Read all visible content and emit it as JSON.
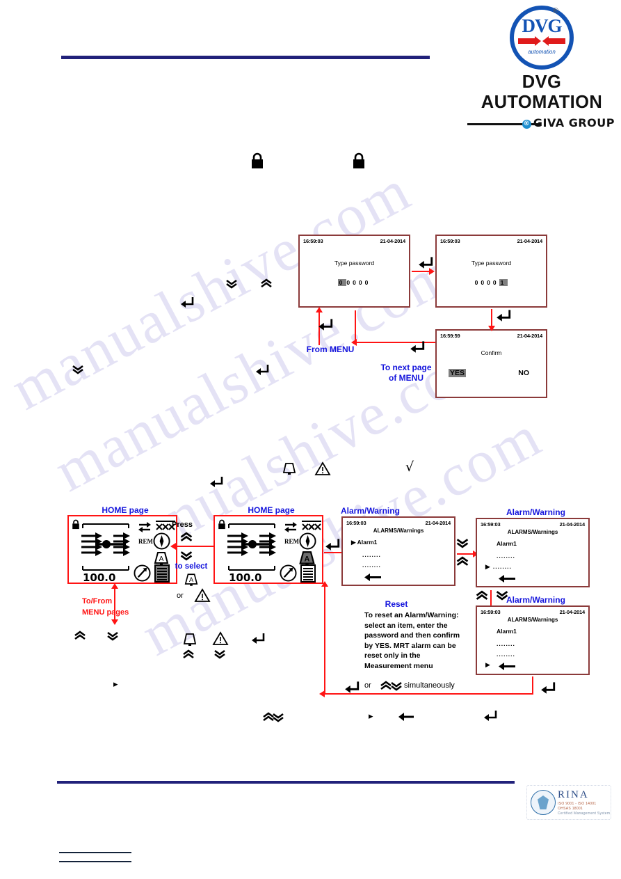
{
  "header": {
    "logo": {
      "mark_text": "DVG",
      "mark_sub": "automation",
      "registered": "®",
      "company": "DVG AUTOMATION",
      "group_badge": "®",
      "group": "GIVA GROUP"
    }
  },
  "watermark": {
    "text": "manualshive.com"
  },
  "symbols": {
    "padlock_left": "padlock-locked",
    "padlock_right": "padlock-locked",
    "chev_down": "⌄",
    "chev_up": "⌃",
    "enter": "↵",
    "bell": "bell",
    "warning": "warning-triangle",
    "check": "√",
    "play": "▸",
    "back": "←"
  },
  "password_flow": {
    "screen1": {
      "time": "16:59:03",
      "date": "21-04-2014",
      "prompt": "Type password",
      "digits": [
        "0",
        "0",
        "0",
        "0",
        "0"
      ],
      "highlight_index": 0
    },
    "screen2": {
      "time": "16:59:03",
      "date": "21-04-2014",
      "prompt": "Type password",
      "digits": [
        "0",
        "0",
        "0",
        "0",
        "1"
      ],
      "highlight_index": 4
    },
    "screen3": {
      "time": "16:59:59",
      "date": "21-04-2014",
      "prompt": "Confirm",
      "yes": "YES",
      "no": "NO",
      "highlight": "YES"
    },
    "labels": {
      "from_menu": "From MENU",
      "to_next_page_l1": "To next page",
      "to_next_page_l2": "of MENU"
    }
  },
  "alarm_flow": {
    "home_left": {
      "caption": "HOME page",
      "value": "100.0",
      "rem": "REM",
      "alarm_letter": "A",
      "selected_icon": "list-icon"
    },
    "home_right": {
      "caption": "HOME page",
      "value": "100.0",
      "rem": "REM",
      "alarm_letter": "A",
      "selected_icon": "bell-icon"
    },
    "press_hint": {
      "press": "Press",
      "to_select": "to select",
      "or": "or",
      "letter": "A"
    },
    "to_from_menu": {
      "l1": "To/From",
      "l2": "MENU pages"
    },
    "alarm1": {
      "caption": "Alarm/Warning",
      "time": "16:59:03",
      "date": "21-04-2014",
      "title": "ALARMS/Warnings",
      "rows": [
        "Alarm1",
        "........",
        "........"
      ],
      "cursor_row": 0,
      "back": "←"
    },
    "alarm2": {
      "caption": "Alarm/Warning",
      "time": "16:59:03",
      "date": "21-04-2014",
      "title": "ALARMS/Warnings",
      "rows": [
        "Alarm1",
        "........",
        "........"
      ],
      "cursor_row": 2,
      "back": "←"
    },
    "alarm3": {
      "caption": "Alarm/Warning",
      "time": "16:59:03",
      "date": "21-04-2014",
      "title": "ALARMS/Warnings",
      "rows": [
        "Alarm1",
        "........",
        "........"
      ],
      "cursor_row": 3,
      "back": "←"
    },
    "reset_note": {
      "title": "Reset",
      "l1": "To reset an Alarm/Warning:",
      "l2": "select an item, enter the",
      "l3": "password and then confirm",
      "l4": "by YES. MRT alarm can be",
      "l5": "reset only in the",
      "l6": "Measurement menu"
    },
    "simultaneously": {
      "or": "or",
      "text": "simultaneously"
    }
  },
  "footer": {
    "rina": {
      "name": "RINA",
      "line1": "ISO 9001 - ISO 14001",
      "line2": "OHSAS 18001",
      "line3": "Certified Management System"
    }
  },
  "colors": {
    "navy_rule": "#21217a",
    "screen_border": "#8b3a3a",
    "accent_red": "#ff1414",
    "label_blue": "#1414dc",
    "logo_blue": "#1353b4"
  }
}
